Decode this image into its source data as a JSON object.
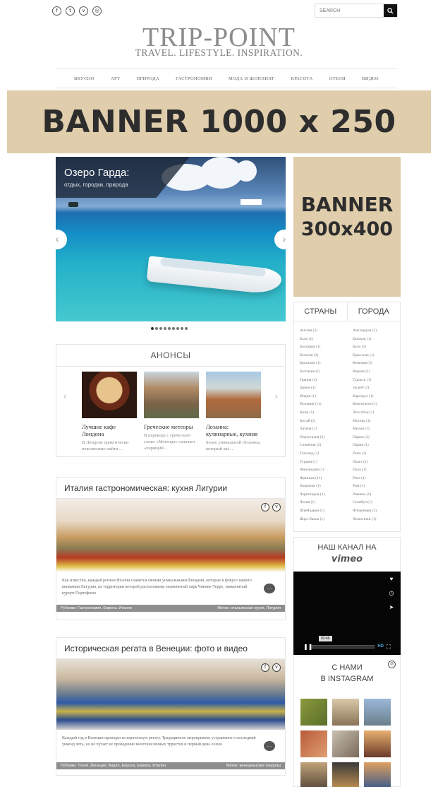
{
  "header": {
    "social_icons": [
      "facebook-icon",
      "twitter-icon",
      "vk-icon",
      "instagram-icon"
    ],
    "search_placeholder": "SEARCH",
    "logo_title": "TRIP-POINT",
    "logo_tagline": "TRAVEL. LIFESTYLE. INSPIRATION."
  },
  "nav": {
    "items": [
      "ВКУСНО",
      "АРТ",
      "ПРИРОДА",
      "ГАСТРОНОМИЯ",
      "МОДА И ШОППИНГ",
      "КРАСОТА",
      "ОТЕЛИ",
      "ВИДЕО"
    ]
  },
  "banner_top": {
    "text": "BANNER 1000 x 250"
  },
  "slider": {
    "title": "Озеро Гарда:",
    "subtitle": "отдых, городки, природа",
    "dots_total": 9,
    "active_dot": 0
  },
  "anons": {
    "heading": "АНОНСЫ",
    "cards": [
      {
        "title": "Лучшие кафе Лондона",
        "desc": "В Лондоне практически невозможно найти ..."
      },
      {
        "title": "Греческие метеоры",
        "desc": "В переводе с греческого слово «Метеора» означает «парящий..."
      },
      {
        "title": "Лозанна: кулинарные, кухния",
        "desc": "Более уникальной Лозанны, который мы ..."
      }
    ]
  },
  "posts": [
    {
      "title": "Италия гастрономическая: кухня Лигурии",
      "excerpt": "Как известно, каждый регион Италии славится своими уникальными блюдами, которые в фокусе нашего внимания Лигурия, на территории которой расположены знаменитый парк Чинкве-Терре, знаменитый курорт Портофино",
      "rubric": "Рубрики: Гастрономия, Европа, Италия",
      "tags": "Метки: итальянская кухня, Лигурия"
    },
    {
      "title": "Историческая регата в Венеции: фото и видео",
      "excerpt": "Каждый год в Венеции проводят историческую регату. Традиционно мероприятие устраивают в последний уикенд лета, но не пугает ее проведение многочисленных туристов и первый день осени",
      "rubric": "Рубрики: Travel, Венеция, Видео, Европа, Европа, Италия",
      "tags": "Метки: венецианские гондолы"
    }
  ],
  "sidebar": {
    "banner_line1": "BANNER",
    "banner_line2": "300x400",
    "tab_countries": "СТРАНЫ",
    "tab_cities": "ГОРОДА",
    "countries": [
      "Англия (2)",
      "Бали (1)",
      "Болгария (1)",
      "Бельгия (1)",
      "Бразилия (1)",
      "Ботсвана (1)",
      "Греция (2)",
      "Дания (1)",
      "Индия (1)",
      "Испания (11)",
      "Кипр (1)",
      "Китай (1)",
      "Латвия (1)",
      "Португалия (3)",
      "Словения (2)",
      "Таиланд (1)",
      "Турция (1)",
      "Финляндия (1)",
      "Франция (11)",
      "Хорватия (1)",
      "Черногория (1)",
      "Чехия (1)",
      "Швейцария (1)",
      "Шри-Ланка (1)"
    ],
    "cities": [
      "Амстердам (2)",
      "Бангкок (1)",
      "Бали (1)",
      "Брюссель (1)",
      "Венеция (3)",
      "Верона (1)",
      "Гданьск (1)",
      "Загреб (1)",
      "Карлсруэ (1)",
      "Копенгаген (1)",
      "Лиссабон (1)",
      "Москва (1)",
      "Милан (1)",
      "Париж (2)",
      "Парма (1)",
      "Пиза (1)",
      "Прага (1)",
      "Пула (1)",
      "Рига (1)",
      "Рим (1)",
      "Римини (1)",
      "Стамбул (1)",
      "Флоренция (1)",
      "Хельсинки (1)"
    ],
    "vimeo_title": "НАШ КАНАЛ НА",
    "vimeo_logo": "vimeo",
    "player_tooltip": "02:46",
    "player_hd": "HD",
    "instagram_line1": "С НАМИ",
    "instagram_line2": "В INSTAGRAM"
  }
}
